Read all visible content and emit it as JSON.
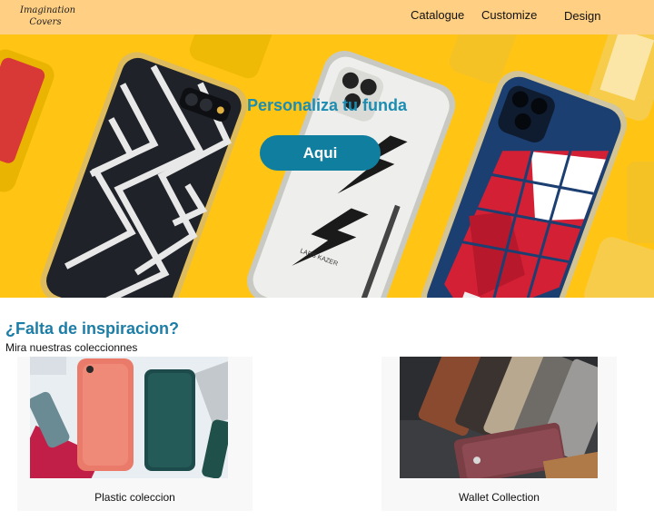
{
  "brand": {
    "logo_line1": "Imagination",
    "logo_line2": "Covers"
  },
  "nav": {
    "catalogue": "Catalogue",
    "customize": "Customize",
    "design": "Design"
  },
  "hero": {
    "title": "Personaliza tu funda",
    "button": "Aqui",
    "case_text": "LARS KAZER"
  },
  "inspiration": {
    "title": "¿Falta de inspiracion?",
    "subtitle": "Mira nuestras coleccionnes"
  },
  "collections": [
    {
      "label": "Plastic coleccion"
    },
    {
      "label": "Wallet Collection"
    }
  ],
  "colors": {
    "header_bg": "#ffcf83",
    "accent": "#107f9f",
    "title_blue": "#1c7ea6",
    "hero_yellow": "#ffc414"
  }
}
